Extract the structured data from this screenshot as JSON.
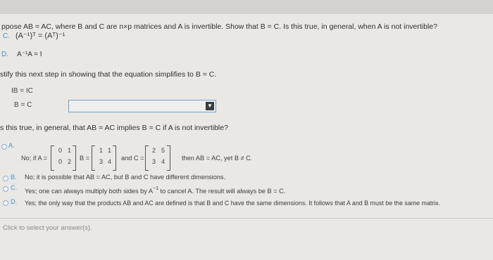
{
  "question": {
    "text": "ppose AB = AC, where B and C are n×p matrices and A is invertible. Show that B = C. Is this true, in general, when A is not invertible?"
  },
  "prior_choices": [
    {
      "letter": "C.",
      "expr": "(A⁻¹)ᵀ = (Aᵀ)⁻¹"
    },
    {
      "letter": "D.",
      "expr": "A⁻¹A = I"
    }
  ],
  "justify": {
    "text": "stify this next step in showing that the equation simplifies to B = C.",
    "line1": "IB  =  IC",
    "line2": "B  =  C",
    "dropdown_value": ""
  },
  "question2": {
    "text": "s this true, in general, that AB = AC implies B = C if A is not invertible?"
  },
  "options": {
    "A": {
      "letter": "A.",
      "prefix": "No; if A =",
      "matrixA": [
        "0",
        "1",
        "0",
        "2"
      ],
      "b_label": "B =",
      "matrixB": [
        "1",
        "1",
        "3",
        "4"
      ],
      "c_label": "and C =",
      "matrixC": [
        "2",
        "5",
        "3",
        "4"
      ],
      "suffix": "then AB = AC, yet B ≠ C."
    },
    "B": {
      "letter": "B.",
      "text": "No; it is possible that AB = AC, but B and C have different dimensions."
    },
    "C": {
      "letter": "C.",
      "text_before": "Yes; one can always multiply both sides by A",
      "sup": "−1",
      "text_after": " to cancel A. The result will always be B = C."
    },
    "D": {
      "letter": "D.",
      "text": "Yes; the only way that the products AB and AC are defined is that B and C have the same dimensions. It follows that A and B must be the same matrix."
    }
  },
  "footer": {
    "hint": "Click to select your answer(s)."
  }
}
